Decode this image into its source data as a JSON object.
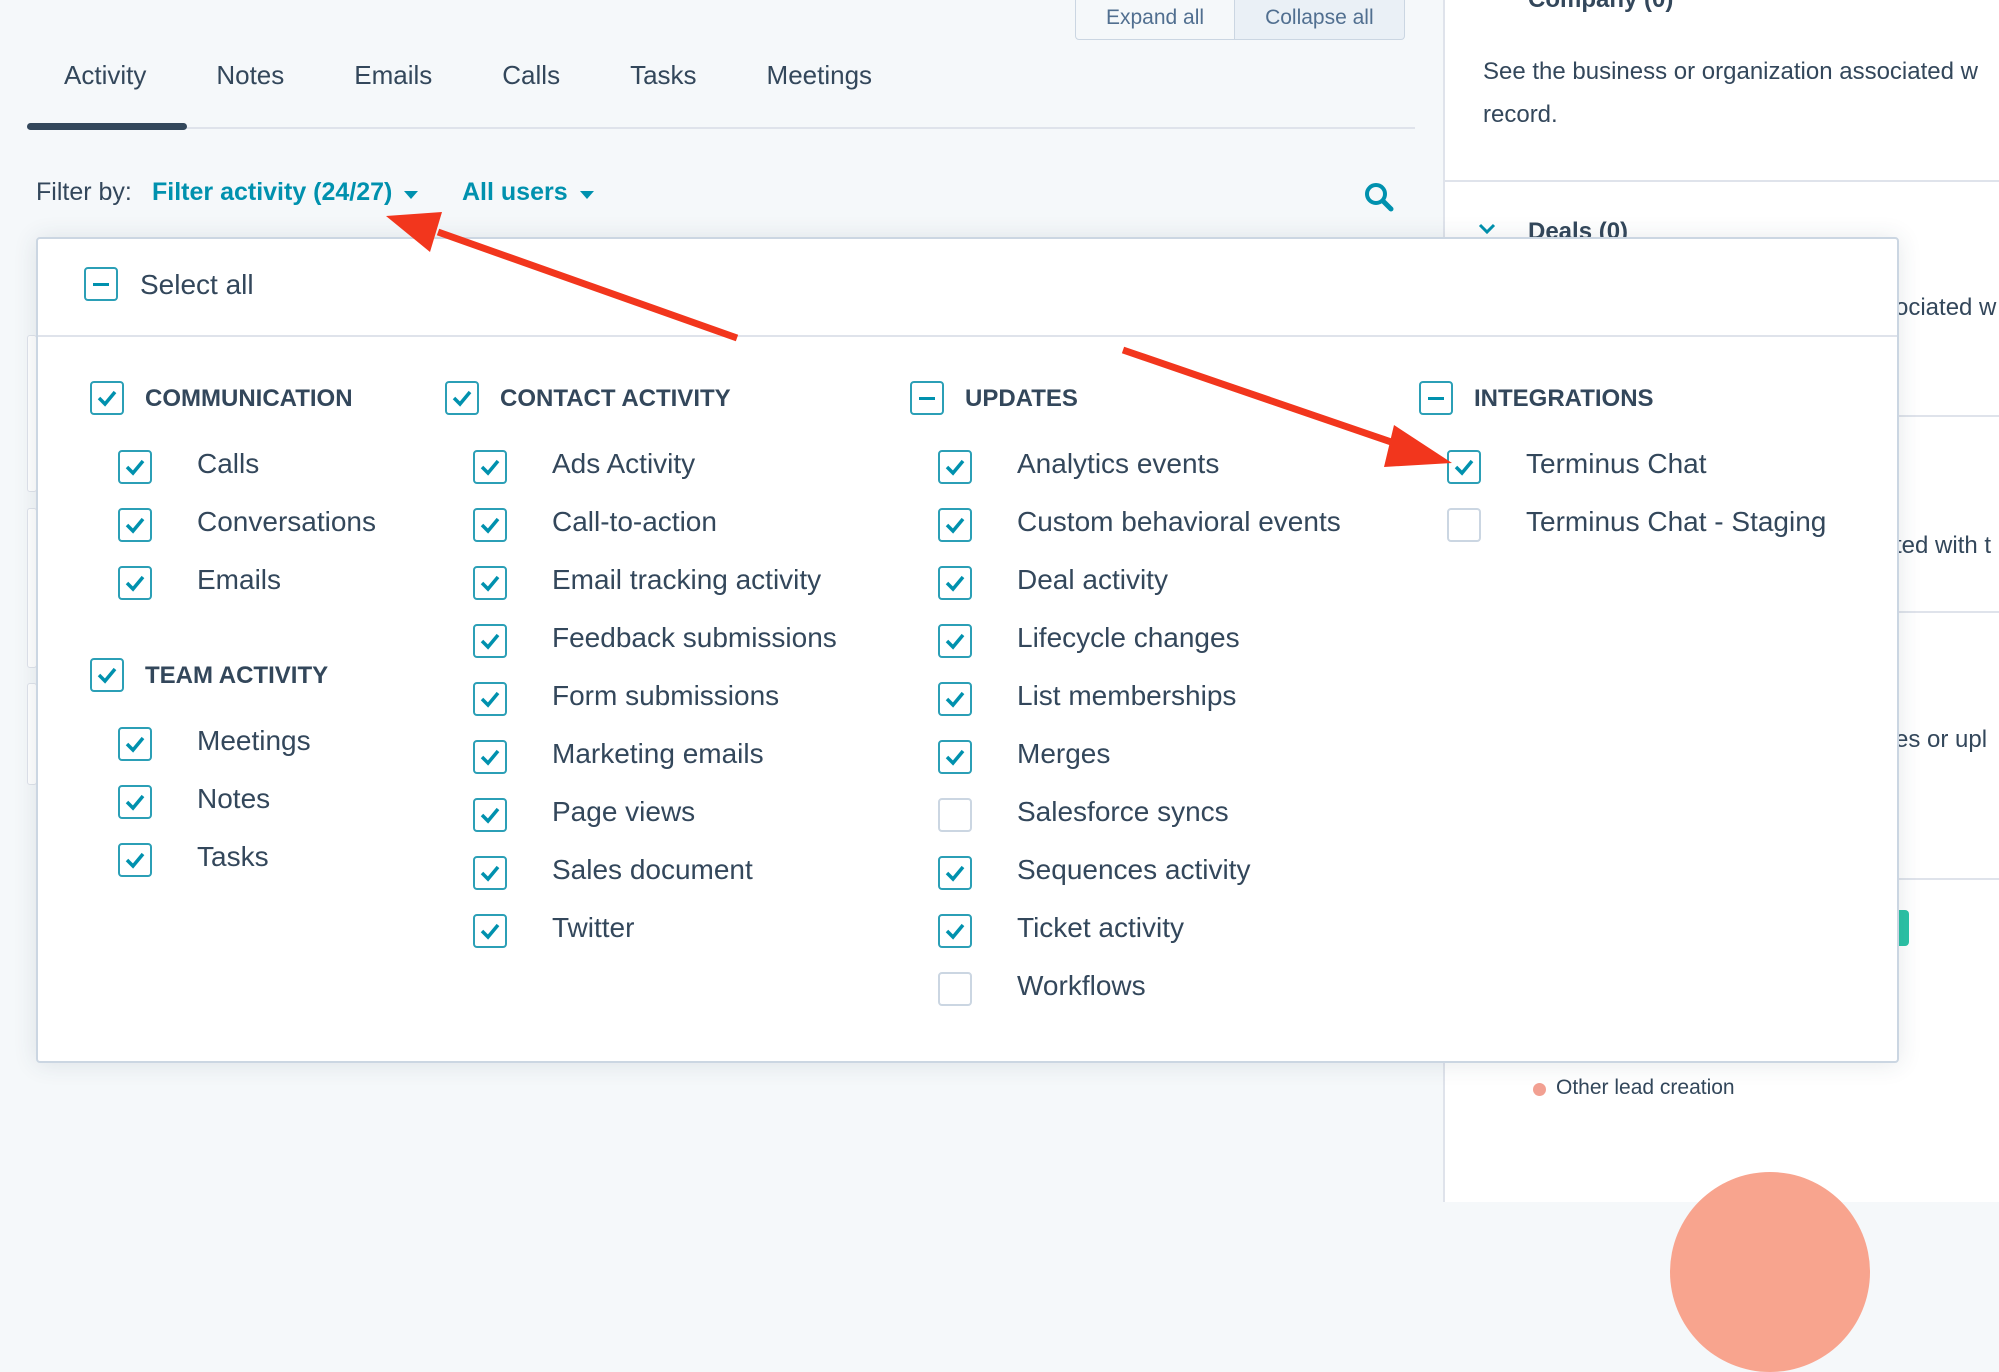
{
  "toolbar": {
    "expand_all": "Expand all",
    "collapse_all": "Collapse all"
  },
  "tabs": [
    "Activity",
    "Notes",
    "Emails",
    "Calls",
    "Tasks",
    "Meetings"
  ],
  "filter": {
    "label": "Filter by:",
    "activity_link": "Filter activity (24/27)",
    "users_link": "All users"
  },
  "right_panel": {
    "company_header": "Company (0)",
    "company_desc_1": "See the business or organization associated w",
    "company_desc_2": "record.",
    "deals_header": "Deals (0)",
    "peek_1": "ociated w",
    "peek_2": "ted with t",
    "peek_3": "es or upl",
    "legend": "Other lead creation"
  },
  "dropdown": {
    "select_all": "Select all",
    "categories": {
      "communication": {
        "label": "COMMUNICATION",
        "items": [
          {
            "label": "Calls",
            "checked": true
          },
          {
            "label": "Conversations",
            "checked": true
          },
          {
            "label": "Emails",
            "checked": true
          }
        ]
      },
      "team_activity": {
        "label": "TEAM ACTIVITY",
        "items": [
          {
            "label": "Meetings",
            "checked": true
          },
          {
            "label": "Notes",
            "checked": true
          },
          {
            "label": "Tasks",
            "checked": true
          }
        ]
      },
      "contact_activity": {
        "label": "CONTACT ACTIVITY",
        "items": [
          {
            "label": "Ads Activity",
            "checked": true
          },
          {
            "label": "Call-to-action",
            "checked": true
          },
          {
            "label": "Email tracking activity",
            "checked": true
          },
          {
            "label": "Feedback submissions",
            "checked": true
          },
          {
            "label": "Form submissions",
            "checked": true
          },
          {
            "label": "Marketing emails",
            "checked": true
          },
          {
            "label": "Page views",
            "checked": true
          },
          {
            "label": "Sales document",
            "checked": true
          },
          {
            "label": "Twitter",
            "checked": true
          }
        ]
      },
      "updates": {
        "label": "UPDATES",
        "items": [
          {
            "label": "Analytics events",
            "checked": true
          },
          {
            "label": "Custom behavioral events",
            "checked": true
          },
          {
            "label": "Deal activity",
            "checked": true
          },
          {
            "label": "Lifecycle changes",
            "checked": true
          },
          {
            "label": "List memberships",
            "checked": true
          },
          {
            "label": "Merges",
            "checked": true
          },
          {
            "label": "Salesforce syncs",
            "checked": false
          },
          {
            "label": "Sequences activity",
            "checked": true
          },
          {
            "label": "Ticket activity",
            "checked": true
          },
          {
            "label": "Workflows",
            "checked": false
          }
        ]
      },
      "integrations": {
        "label": "INTEGRATIONS",
        "items": [
          {
            "label": "Terminus Chat",
            "checked": true
          },
          {
            "label": "Terminus Chat - Staging",
            "checked": false
          }
        ]
      }
    }
  },
  "colors": {
    "accent": "#0091ae",
    "annotation_arrow": "#f2361d",
    "text": "#33475b"
  },
  "icons": [
    "search-icon",
    "caret-down-icon",
    "chevron-down-icon",
    "checkbox-checked-icon",
    "checkbox-indeterminate-icon"
  ]
}
